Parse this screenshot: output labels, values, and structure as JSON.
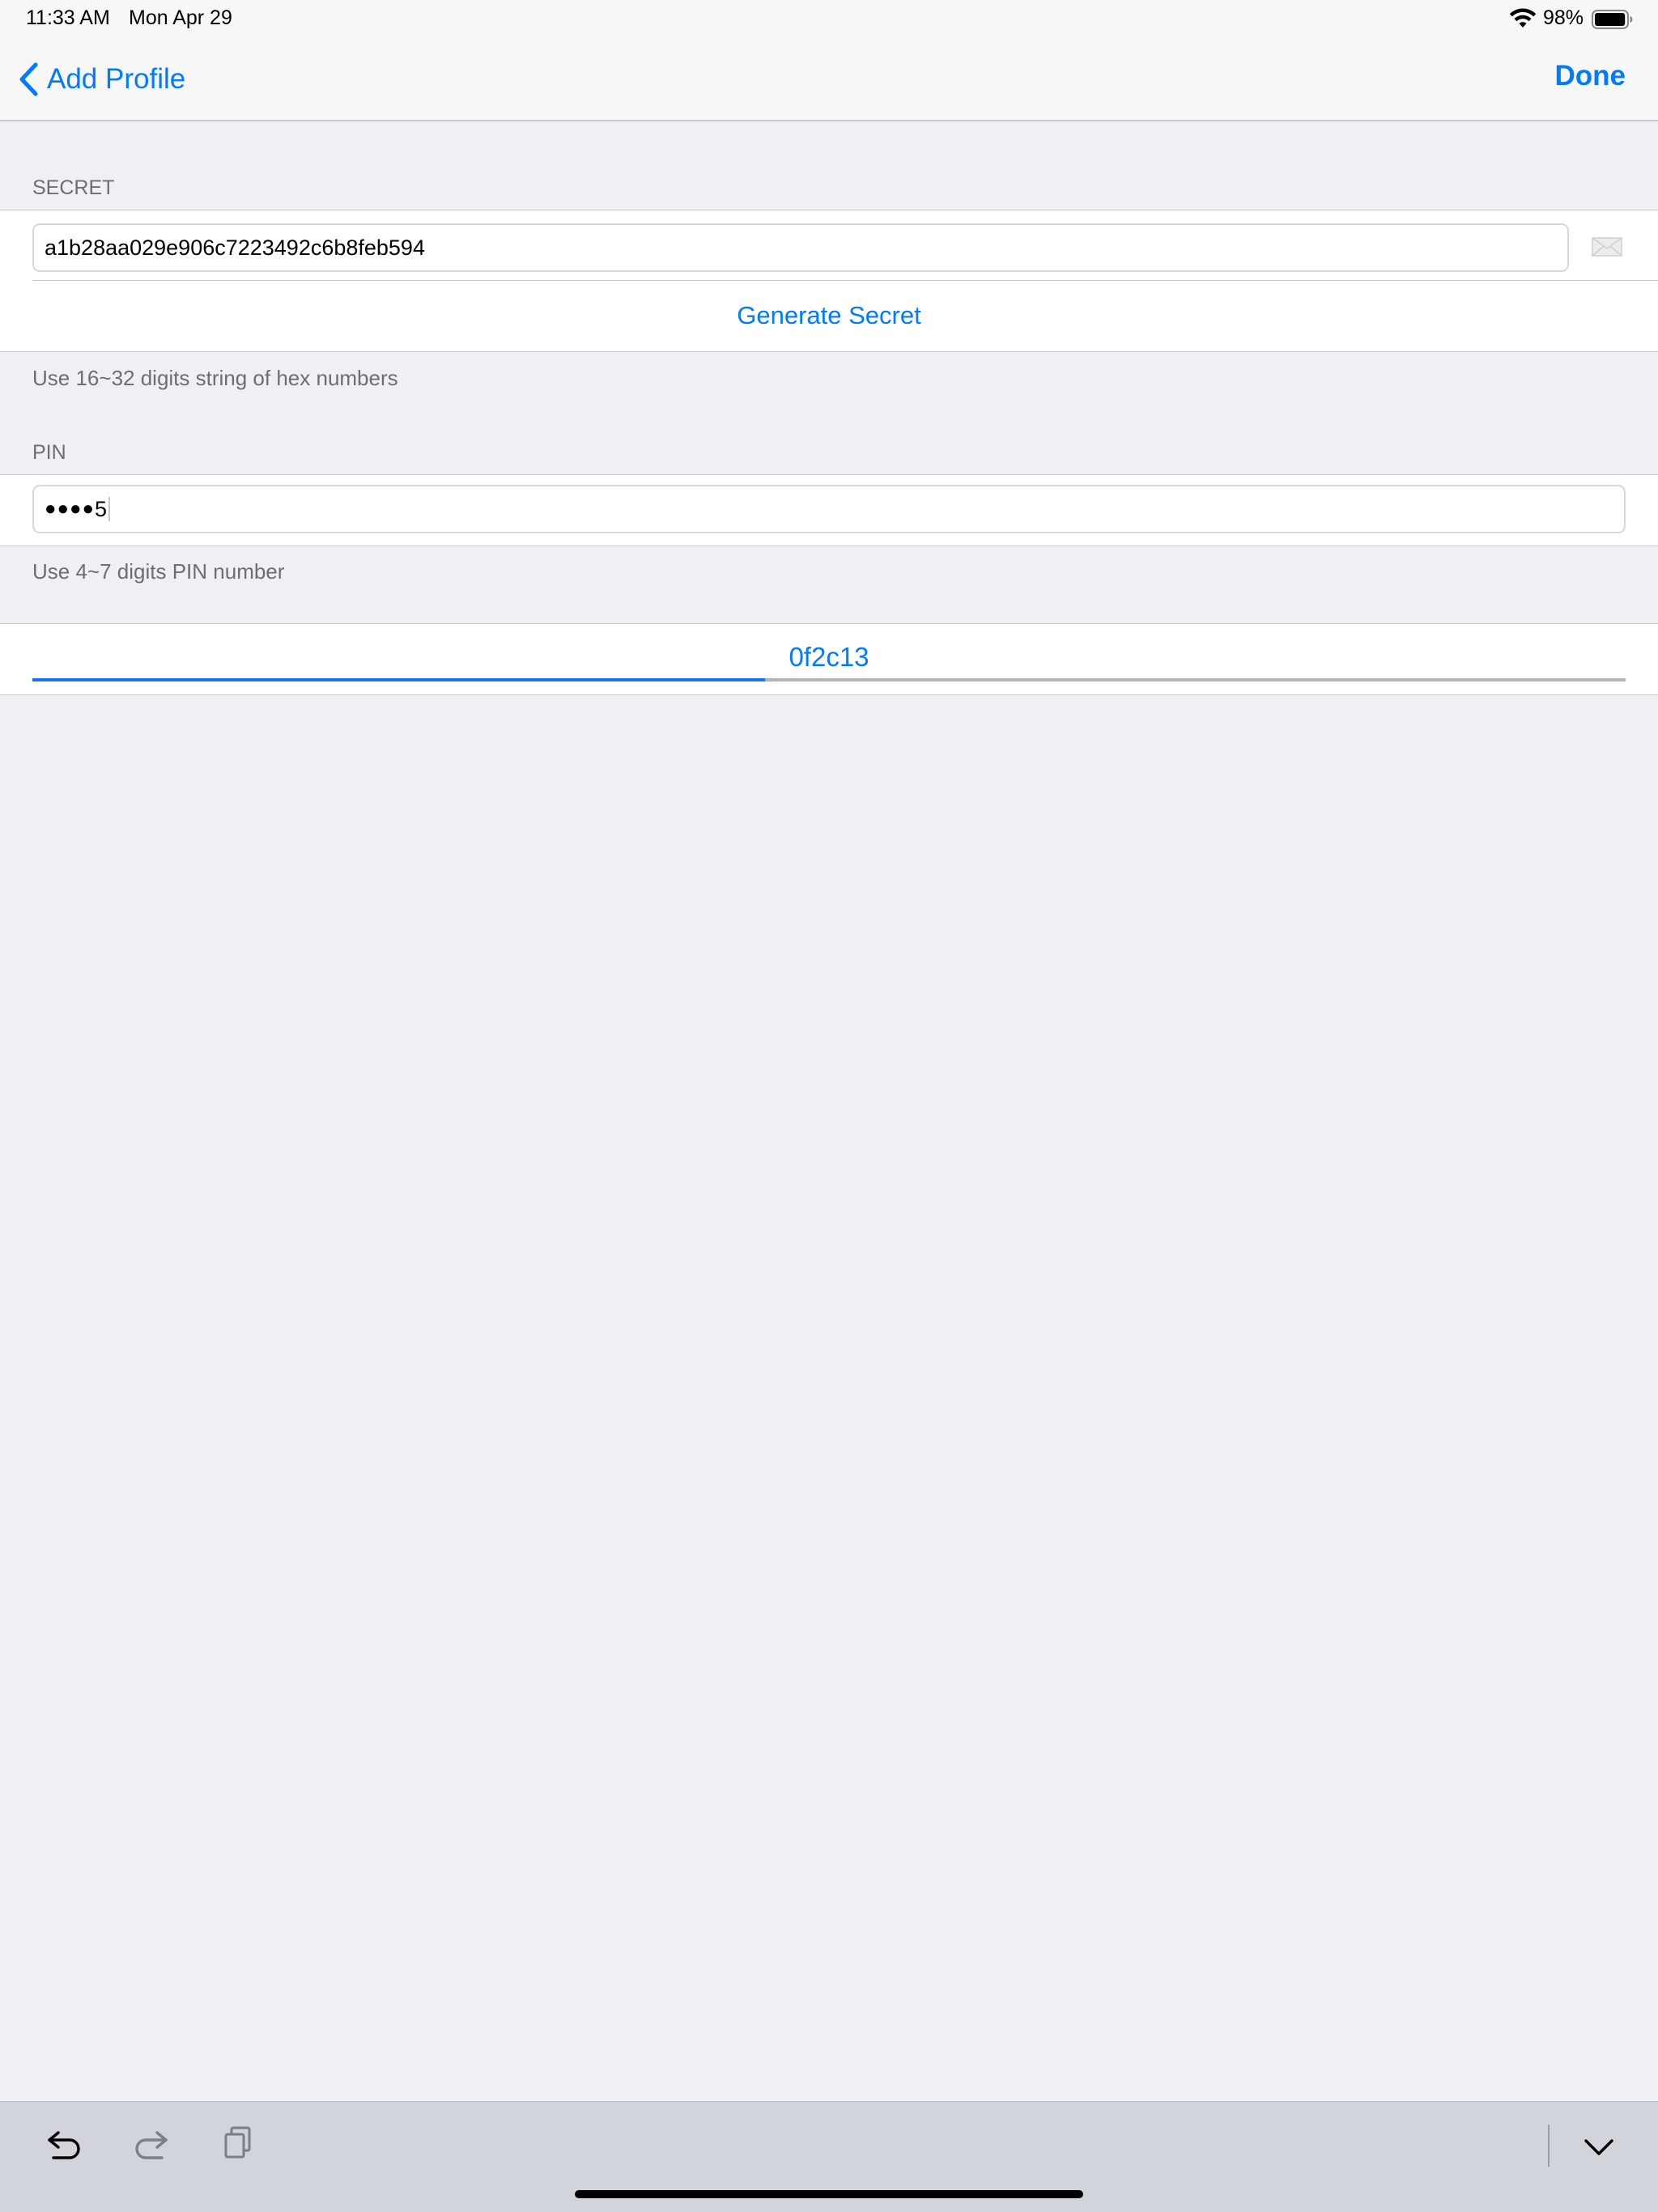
{
  "status_bar": {
    "time": "11:33 AM",
    "date": "Mon Apr 29",
    "battery_percent": "98%",
    "battery_level": 0.98
  },
  "nav": {
    "back_label": "Add Profile",
    "done_label": "Done"
  },
  "secret_section": {
    "header": "SECRET",
    "value": "a1b28aa029e906c7223492c6b8feb594",
    "generate_label": "Generate Secret",
    "footer": "Use 16~32 digits string of hex numbers"
  },
  "pin_section": {
    "header": "PIN",
    "masked_dots": "●●●●",
    "last_char": "5",
    "footer": "Use 4~7 digits PIN number"
  },
  "code_section": {
    "code": "0f2c13",
    "progress": 0.46
  },
  "colors": {
    "accent": "#007aff",
    "background": "#efeff4",
    "progress_fill": "#1a73e8",
    "progress_track": "#b4b4b4"
  },
  "keyboard_shortcuts": {
    "icons": [
      "undo-icon",
      "redo-icon",
      "paste-icon",
      "dismiss-keyboard-icon"
    ]
  }
}
